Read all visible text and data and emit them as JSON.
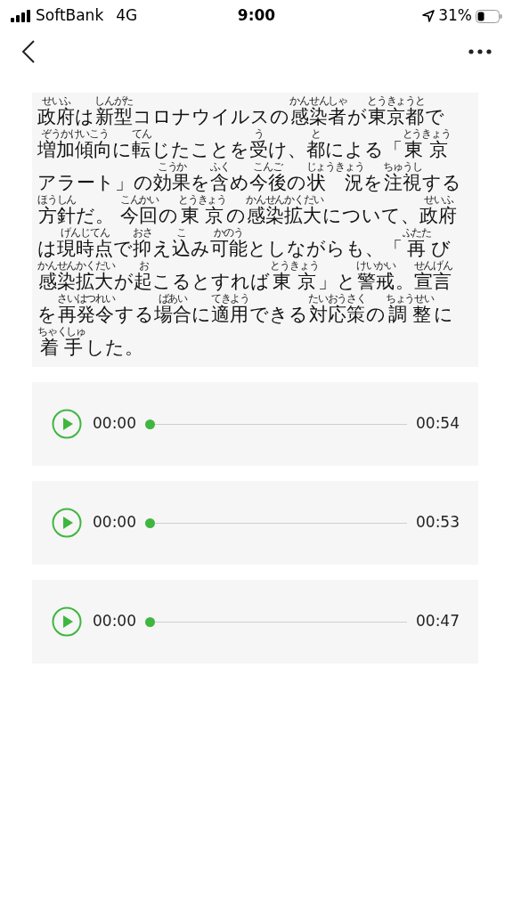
{
  "status_bar": {
    "carrier": "SoftBank",
    "network": "4G",
    "time": "9:00",
    "battery": "31%"
  },
  "article": {
    "lines": [
      [
        {
          "text": "政府",
          "ruby": "せいふ"
        },
        {
          "text": "は"
        },
        {
          "text": "新型",
          "ruby": "しんがた"
        },
        {
          "text": "コロナウイルスの"
        },
        {
          "text": "感染者",
          "ruby": "かんせんしゃ"
        },
        {
          "text": "が"
        },
        {
          "text": "東京都",
          "ruby": "とうきょうと"
        },
        {
          "text": "で"
        }
      ],
      [
        {
          "text": "増加傾向",
          "ruby": "ぞうかけいこう"
        },
        {
          "text": "に"
        },
        {
          "text": "転",
          "ruby": "てん"
        },
        {
          "text": "じたことを"
        },
        {
          "text": "受",
          "ruby": "う"
        },
        {
          "text": "け、"
        },
        {
          "text": "都",
          "ruby": "と"
        },
        {
          "text": "による「"
        },
        {
          "text": "東 京",
          "ruby": "とうきょう"
        }
      ],
      [
        {
          "text": "アラート」の"
        },
        {
          "text": "効果",
          "ruby": "こうか"
        },
        {
          "text": "を"
        },
        {
          "text": "含",
          "ruby": "ふく"
        },
        {
          "text": "め"
        },
        {
          "text": "今後",
          "ruby": "こんご"
        },
        {
          "text": "の"
        },
        {
          "text": "状　況",
          "ruby": "じょうきょう"
        },
        {
          "text": "を"
        },
        {
          "text": "注視",
          "ruby": "ちゅうし"
        },
        {
          "text": "する"
        }
      ],
      [
        {
          "text": "方針",
          "ruby": "ほうしん"
        },
        {
          "text": "だ。 "
        },
        {
          "text": "今回",
          "ruby": "こんかい"
        },
        {
          "text": "の"
        },
        {
          "text": "東 京",
          "ruby": "とうきょう"
        },
        {
          "text": "の"
        },
        {
          "text": "感染拡大",
          "ruby": "かんせんかくだい"
        },
        {
          "text": "について、"
        },
        {
          "text": "政府",
          "ruby": "せいふ"
        }
      ],
      [
        {
          "text": "は"
        },
        {
          "text": "現時点",
          "ruby": "げんじてん"
        },
        {
          "text": "で"
        },
        {
          "text": "抑",
          "ruby": "おさ"
        },
        {
          "text": "え"
        },
        {
          "text": "込",
          "ruby": "こ"
        },
        {
          "text": "み"
        },
        {
          "text": "可能",
          "ruby": "かのう"
        },
        {
          "text": "としながらも、「"
        },
        {
          "text": "再",
          "ruby": "ふたた"
        },
        {
          "text": "び"
        }
      ],
      [
        {
          "text": "感染拡大",
          "ruby": "かんせんかくだい"
        },
        {
          "text": "が"
        },
        {
          "text": "起",
          "ruby": "お"
        },
        {
          "text": "こるとすれば"
        },
        {
          "text": "東 京",
          "ruby": "とうきょう"
        },
        {
          "text": "」と"
        },
        {
          "text": "警戒",
          "ruby": "けいかい"
        },
        {
          "text": "。"
        },
        {
          "text": "宣言",
          "ruby": "せんげん"
        }
      ],
      [
        {
          "text": "を"
        },
        {
          "text": "再発令",
          "ruby": "さいはつれい"
        },
        {
          "text": "する"
        },
        {
          "text": "場合",
          "ruby": "ばあい"
        },
        {
          "text": "に"
        },
        {
          "text": "適用",
          "ruby": "てきよう"
        },
        {
          "text": "できる"
        },
        {
          "text": "対応策",
          "ruby": "たいおうさく"
        },
        {
          "text": "の"
        },
        {
          "text": "調 整",
          "ruby": "ちょうせい"
        },
        {
          "text": "に"
        }
      ],
      [
        {
          "text": "着 手",
          "ruby": "ちゃくしゅ"
        },
        {
          "text": "した。"
        }
      ]
    ]
  },
  "players": [
    {
      "current": "00:00",
      "duration": "00:54",
      "level": 0
    },
    {
      "current": "00:00",
      "duration": "00:53",
      "level": 0
    },
    {
      "current": "00:00",
      "duration": "00:47",
      "level": 0
    }
  ]
}
